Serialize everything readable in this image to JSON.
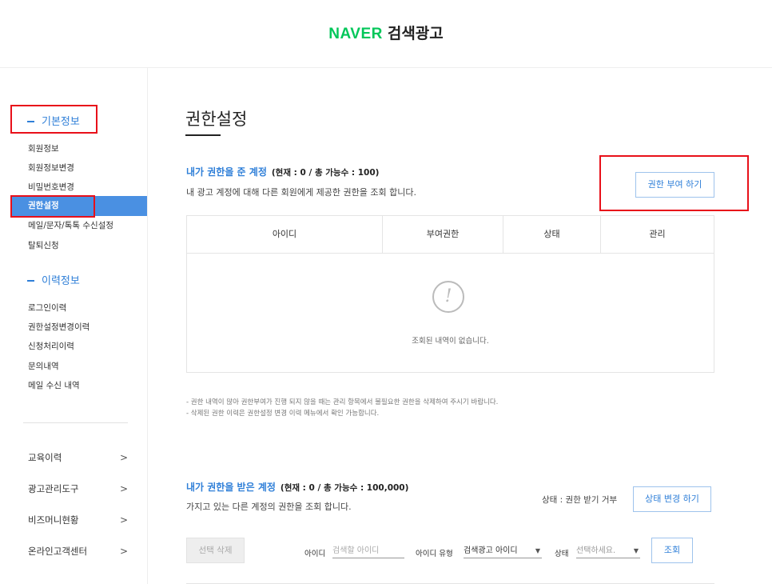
{
  "header": {
    "brand": "NAVER",
    "service": "검색광고"
  },
  "sidebar": {
    "basic_title": "기본정보",
    "basic_items": [
      "회원정보",
      "회원정보변경",
      "비밀번호변경",
      "권한설정",
      "메일/문자/톡톡 수신설정",
      "탈퇴신청"
    ],
    "history_title": "이력정보",
    "history_items": [
      "로그인이력",
      "권한설정변경이력",
      "신청처리이력",
      "문의내역",
      "메일 수신 내역"
    ],
    "bottom_items": [
      "교육이력",
      "광고관리도구",
      "비즈머니현황",
      "온라인고객센터"
    ],
    "chevron": ">"
  },
  "main": {
    "page_title": "권한설정",
    "given": {
      "title": "내가 권한을 준 계정",
      "count": "(현재 : 0 / 총 가능수 : 100)",
      "description": "내 광고 계정에 대해 다른 회원에게 제공한 권한을 조회 합니다.",
      "grant_button": "권한 부여 하기",
      "columns": [
        "아이디",
        "부여권한",
        "상태",
        "관리"
      ],
      "empty_icon": "!",
      "empty_text": "조회된 내역이 없습니다.",
      "notes": [
        "- 권한 내역이 많아 권한부여가 진행 되지 않을 때는 관리 항목에서 불필요한 권한을 삭제하여 주시기 바랍니다.",
        "- 삭제된 권한 이력은 권한설정 변경 이력 메뉴에서 확인 가능합니다."
      ]
    },
    "received": {
      "title": "내가 권한을 받은 계정",
      "count": "(현재 : 0 / 총 가능수 : 100,000)",
      "description": "가지고 있는 다른 계정의 권한을 조회 합니다.",
      "status_text": "상태 : 권한 받기 거부",
      "status_button": "상태 변경 하기",
      "delete_button": "선택 삭제",
      "id_label": "아이디",
      "id_placeholder": "검색할 아이디",
      "id_type_label": "아이디 유형",
      "id_type_value": "검색광고 아이디",
      "state_label": "상태",
      "state_value": "선택하세요.",
      "search_button": "조회"
    }
  },
  "colors": {
    "accent": "#2f7fd8",
    "active_bg": "#4a90e2",
    "brand_green": "#03c75a",
    "highlight_red": "#e8101a"
  }
}
